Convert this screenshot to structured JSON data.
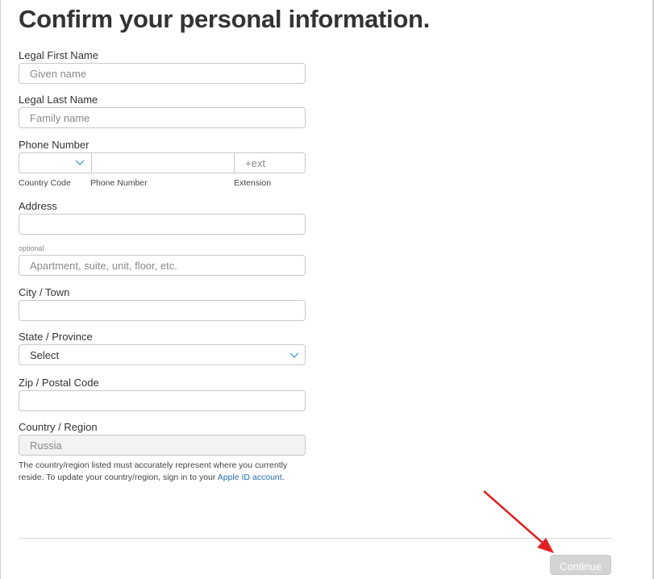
{
  "page": {
    "title": "Confirm your personal information."
  },
  "form": {
    "first_name": {
      "label": "Legal First Name",
      "placeholder": "Given name",
      "value": ""
    },
    "last_name": {
      "label": "Legal Last Name",
      "placeholder": "Family name",
      "value": ""
    },
    "phone": {
      "label": "Phone Number",
      "country_code": {
        "sublabel": "Country Code",
        "value": "",
        "icon": "chevron-down-icon"
      },
      "number": {
        "sublabel": "Phone Number",
        "value": ""
      },
      "extension": {
        "sublabel": "Extension",
        "placeholder": "+ext",
        "value": ""
      }
    },
    "address": {
      "label": "Address",
      "value": ""
    },
    "address2": {
      "label": "optional",
      "placeholder": "Apartment, suite, unit, floor, etc.",
      "value": ""
    },
    "city": {
      "label": "City / Town",
      "value": ""
    },
    "state": {
      "label": "State / Province",
      "selected": "Select",
      "icon": "chevron-down-icon"
    },
    "zip": {
      "label": "Zip / Postal Code",
      "value": ""
    },
    "country": {
      "label": "Country / Region",
      "value": "Russia",
      "disabled": true
    },
    "helper": {
      "text": "The country/region listed must accurately represent where you currently reside. To update your country/region, sign in to your ",
      "link_label": "Apple ID account",
      "suffix": "."
    }
  },
  "footer": {
    "continue_label": "Continue",
    "continue_enabled": false
  },
  "annotation": {
    "arrow_color": "#e02020",
    "points_to": "continue-button"
  },
  "colors": {
    "link": "#2b6cb0",
    "chevron": "#4a9ac8",
    "disabled_button": "#d4d4d4"
  }
}
